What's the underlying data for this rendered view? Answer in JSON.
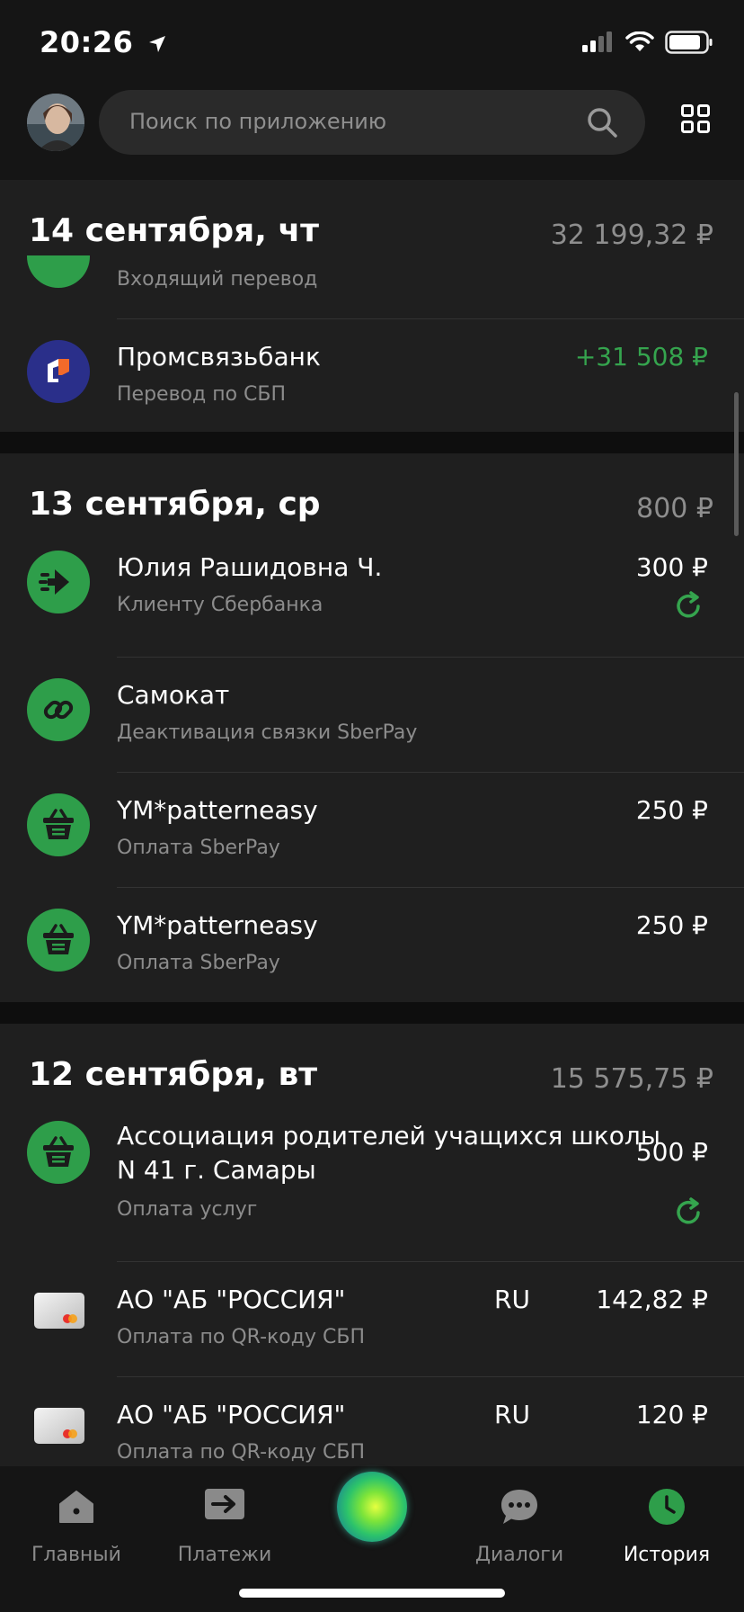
{
  "status": {
    "time": "20:26"
  },
  "search": {
    "placeholder": "Поиск по приложению"
  },
  "groups": [
    {
      "title": "14 сентября, чт",
      "total": "32 199,32 ₽",
      "rows": [
        {
          "title": "",
          "subtitle": "Входящий перевод",
          "amount": "",
          "icon": "incoming-icon"
        },
        {
          "title": "Промсвязьбанк",
          "subtitle": "Перевод по СБП",
          "amount": "+31 508 ₽",
          "icon": "psb-logo"
        }
      ]
    },
    {
      "title": "13 сентября, ср",
      "total": "800 ₽",
      "rows": [
        {
          "title": "Юлия Рашидовна Ч.",
          "subtitle": "Клиенту Сбербанка",
          "amount": "300 ₽",
          "icon": "transfer-arrow-icon",
          "repeat": true
        },
        {
          "title": "Самокат",
          "subtitle": "Деактивация связки SberPay",
          "amount": "",
          "icon": "link-icon"
        },
        {
          "title": "YM*patterneasy",
          "subtitle": "Оплата SberPay",
          "amount": "250 ₽",
          "icon": "basket-icon"
        },
        {
          "title": "YM*patterneasy",
          "subtitle": "Оплата SberPay",
          "amount": "250 ₽",
          "icon": "basket-icon"
        }
      ]
    },
    {
      "title": "12 сентября, вт",
      "total": "15 575,75 ₽",
      "rows": [
        {
          "title_line1": "Ассоциация родителей учащихся школы",
          "title_line2": "N 41 г. Самары",
          "subtitle": "Оплата услуг",
          "amount": "500 ₽",
          "icon": "basket-icon",
          "repeat": true
        },
        {
          "title": "АО \"АБ \"РОССИЯ\"",
          "country": "RU",
          "subtitle": "Оплата по QR-коду СБП",
          "amount": "142,82 ₽",
          "icon": "card-icon"
        },
        {
          "title": "АО \"АБ \"РОССИЯ\"",
          "country": "RU",
          "subtitle": "Оплата по QR-коду СБП",
          "amount": "120 ₽",
          "icon": "card-icon"
        }
      ]
    }
  ],
  "tabs": [
    {
      "label": "Главный",
      "icon": "home-icon"
    },
    {
      "label": "Платежи",
      "icon": "payments-icon"
    },
    {
      "label": "",
      "icon": "assistant-orb"
    },
    {
      "label": "Диалоги",
      "icon": "chat-icon"
    },
    {
      "label": "История",
      "icon": "clock-icon",
      "active": true
    }
  ],
  "colors": {
    "accent": "#2E9E4A",
    "positive": "#35A44E",
    "background": "#1F1F1F"
  }
}
